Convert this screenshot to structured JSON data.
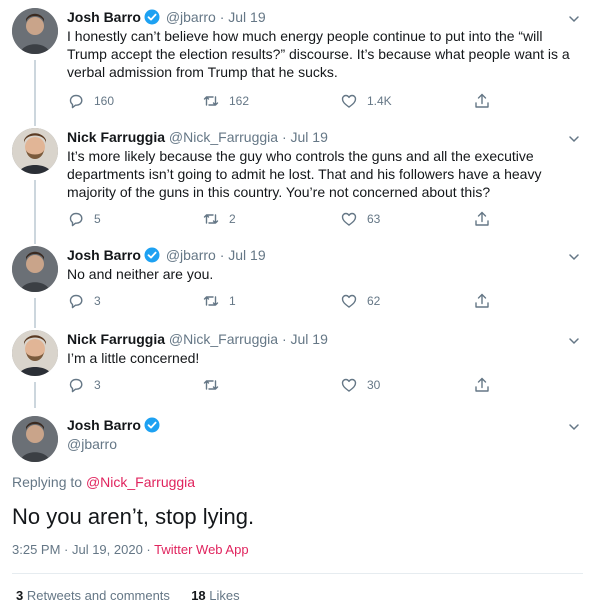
{
  "colors": {
    "text": "#14171a",
    "secondary": "#657786",
    "verified": "#1da1f2",
    "link": "#e0245e",
    "thread_line": "#ccd6dd",
    "divider": "#e6ecf0"
  },
  "thread": [
    {
      "name": "Josh Barro",
      "verified": true,
      "handle": "@jbarro",
      "date": "· Jul 19",
      "text": "I honestly can’t believe how much energy people continue to put into the “will Trump accept the election results?” discourse. It’s because what people want is a verbal admission from Trump that he sucks.",
      "replies": "160",
      "retweets": "162",
      "likes": "1.4K"
    },
    {
      "name": "Nick Farruggia",
      "verified": false,
      "handle": "@Nick_Farruggia",
      "date": "· Jul 19",
      "text": "It’s more likely because the guy who controls the guns and all the executive departments isn’t going to admit he lost. That and his followers have a heavy majority of the guns in this country. You’re not concerned about this?",
      "replies": "5",
      "retweets": "2",
      "likes": "63"
    },
    {
      "name": "Josh Barro",
      "verified": true,
      "handle": "@jbarro",
      "date": "· Jul 19",
      "text": "No and neither are you.",
      "replies": "3",
      "retweets": "1",
      "likes": "62"
    },
    {
      "name": "Nick Farruggia",
      "verified": false,
      "handle": "@Nick_Farruggia",
      "date": "· Jul 19",
      "text": "I’m a little concerned!",
      "replies": "3",
      "retweets": "",
      "likes": "30"
    }
  ],
  "main_tweet": {
    "name": "Josh Barro",
    "handle": "@jbarro",
    "replying_prefix": "Replying to",
    "replying_to": "@Nick_Farruggia",
    "text": "No you aren’t, stop lying.",
    "time": "3:25 PM · Jul 19, 2020 ·",
    "source": "Twitter Web App",
    "retweets_count": "3",
    "retweets_label": "Retweets and comments",
    "likes_count": "18",
    "likes_label": "Likes"
  },
  "icons": {
    "reply": "reply-icon",
    "retweet": "retweet-icon",
    "like": "heart-icon",
    "share": "share-icon",
    "more": "chevron-down-icon",
    "verified": "verified-badge-icon"
  }
}
